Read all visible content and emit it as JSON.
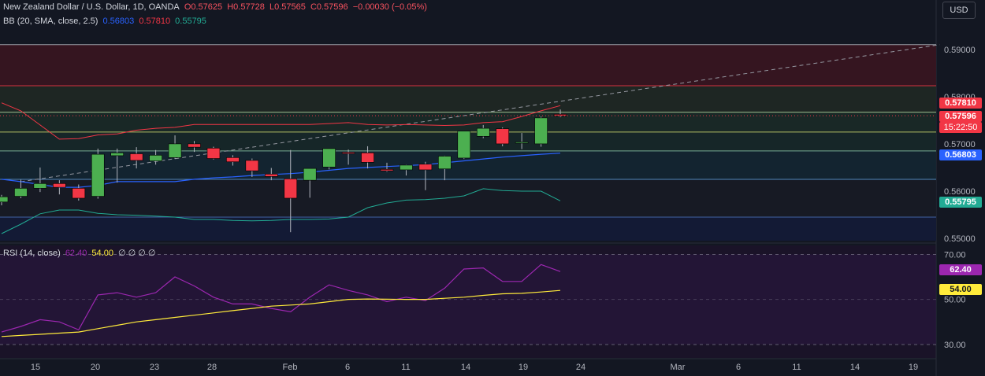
{
  "header": {
    "symbol_line": "New Zealand Dollar / U.S. Dollar, 1D, OANDA",
    "open": "O0.57625",
    "high": "H0.57728",
    "low": "L0.57565",
    "close": "C0.57596",
    "change": "−0.00030 (−0.05%)",
    "bb_label": "BB (20, SMA, close, 2.5)",
    "bb_basis": "0.56803",
    "bb_upper": "0.57810",
    "bb_lower": "0.55795",
    "currency_button": "USD"
  },
  "rsi_legend": {
    "label": "RSI (14, close)",
    "rsi_value": "62.40",
    "ma_value": "54.00",
    "extra": "∅ ∅ ∅ ∅"
  },
  "price_tags": {
    "upper": "0.57810",
    "last": "0.57596",
    "countdown": "15:22:50",
    "basis": "0.56803",
    "lower": "0.55795",
    "rsi": "62.40",
    "rsi_ma": "54.00"
  },
  "colors": {
    "background": "#131722",
    "bull": "#4caf50",
    "bear": "#f23645",
    "bb_upper": "#f23645",
    "bb_basis": "#2962ff",
    "bb_lower": "#22ab94",
    "rsi": "#9c27b0",
    "rsi_ma": "#ffeb3b"
  },
  "chart_data": [
    {
      "type": "candlestick",
      "title": "New Zealand Dollar / U.S. Dollar, 1D, OANDA",
      "x_ticks": [
        "15",
        "20",
        "23",
        "28",
        "Feb",
        "6",
        "11",
        "14",
        "19",
        "24",
        "Mar",
        "6",
        "11",
        "14",
        "19"
      ],
      "y_ticks": [
        "0.55000",
        "0.56000",
        "0.57000",
        "0.58000",
        "0.59000"
      ],
      "ylim": [
        0.5495,
        0.5918
      ],
      "candles": [
        {
          "o": 0.5577,
          "h": 0.5592,
          "l": 0.557,
          "c": 0.5588
        },
        {
          "o": 0.5589,
          "h": 0.5624,
          "l": 0.5585,
          "c": 0.5606
        },
        {
          "o": 0.5606,
          "h": 0.565,
          "l": 0.5598,
          "c": 0.5616
        },
        {
          "o": 0.5616,
          "h": 0.5623,
          "l": 0.5593,
          "c": 0.5608
        },
        {
          "o": 0.5606,
          "h": 0.5614,
          "l": 0.558,
          "c": 0.5585
        },
        {
          "o": 0.5589,
          "h": 0.569,
          "l": 0.5584,
          "c": 0.5678
        },
        {
          "o": 0.5675,
          "h": 0.569,
          "l": 0.5618,
          "c": 0.5681
        },
        {
          "o": 0.5679,
          "h": 0.5693,
          "l": 0.5648,
          "c": 0.5665
        },
        {
          "o": 0.5664,
          "h": 0.5687,
          "l": 0.5656,
          "c": 0.5676
        },
        {
          "o": 0.5671,
          "h": 0.5718,
          "l": 0.5668,
          "c": 0.57
        },
        {
          "o": 0.57,
          "h": 0.5706,
          "l": 0.5683,
          "c": 0.5693
        },
        {
          "o": 0.5691,
          "h": 0.5694,
          "l": 0.5667,
          "c": 0.5669
        },
        {
          "o": 0.5671,
          "h": 0.5676,
          "l": 0.5654,
          "c": 0.5662
        },
        {
          "o": 0.5665,
          "h": 0.5669,
          "l": 0.563,
          "c": 0.5643
        },
        {
          "o": 0.5636,
          "h": 0.5649,
          "l": 0.5623,
          "c": 0.5631
        },
        {
          "o": 0.5626,
          "h": 0.5687,
          "l": 0.5513,
          "c": 0.5585
        },
        {
          "o": 0.5623,
          "h": 0.5648,
          "l": 0.5586,
          "c": 0.5648
        },
        {
          "o": 0.5651,
          "h": 0.569,
          "l": 0.5646,
          "c": 0.569
        },
        {
          "o": 0.5682,
          "h": 0.5688,
          "l": 0.5656,
          "c": 0.5681
        },
        {
          "o": 0.5681,
          "h": 0.5695,
          "l": 0.5648,
          "c": 0.5661
        },
        {
          "o": 0.5646,
          "h": 0.566,
          "l": 0.5641,
          "c": 0.5643
        },
        {
          "o": 0.5645,
          "h": 0.5656,
          "l": 0.5633,
          "c": 0.5655
        },
        {
          "o": 0.5657,
          "h": 0.5662,
          "l": 0.5602,
          "c": 0.5645
        },
        {
          "o": 0.5647,
          "h": 0.5675,
          "l": 0.5623,
          "c": 0.5674
        },
        {
          "o": 0.567,
          "h": 0.5727,
          "l": 0.5668,
          "c": 0.5727
        },
        {
          "o": 0.5716,
          "h": 0.574,
          "l": 0.5712,
          "c": 0.5733
        },
        {
          "o": 0.5732,
          "h": 0.5735,
          "l": 0.5695,
          "c": 0.57
        },
        {
          "o": 0.5702,
          "h": 0.5723,
          "l": 0.5689,
          "c": 0.5704
        },
        {
          "o": 0.57,
          "h": 0.5758,
          "l": 0.5694,
          "c": 0.5755
        },
        {
          "o": 0.57625,
          "h": 0.57728,
          "l": 0.57565,
          "c": 0.57596
        }
      ],
      "bb_upper": [
        0.5787,
        0.577,
        0.574,
        0.571,
        0.5711,
        0.5719,
        0.5721,
        0.5729,
        0.5733,
        0.5735,
        0.5741,
        0.5741,
        0.5741,
        0.5741,
        0.5741,
        0.5741,
        0.5741,
        0.5743,
        0.5745,
        0.5741,
        0.574,
        0.5741,
        0.574,
        0.5739,
        0.574,
        0.5745,
        0.5747,
        0.5758,
        0.577,
        0.5781
      ],
      "bb_basis": [
        0.5625,
        0.562,
        0.5614,
        0.5608,
        0.5608,
        0.5612,
        0.562,
        0.562,
        0.562,
        0.562,
        0.5625,
        0.5628,
        0.563,
        0.5633,
        0.5635,
        0.5637,
        0.564,
        0.5644,
        0.5648,
        0.565,
        0.5652,
        0.5654,
        0.5656,
        0.566,
        0.5664,
        0.5668,
        0.5672,
        0.5675,
        0.5678,
        0.56803
      ],
      "bb_lower": [
        0.551,
        0.553,
        0.5552,
        0.556,
        0.556,
        0.5553,
        0.555,
        0.5549,
        0.5547,
        0.5545,
        0.554,
        0.554,
        0.5538,
        0.5537,
        0.5538,
        0.554,
        0.554,
        0.5541,
        0.5545,
        0.5565,
        0.5575,
        0.5581,
        0.5582,
        0.5585,
        0.559,
        0.5605,
        0.5601,
        0.56,
        0.56,
        0.55795
      ],
      "levels": [
        {
          "value": 0.591,
          "color": "#b2b5be"
        },
        {
          "value": 0.5823,
          "color": "#f23645"
        },
        {
          "value": 0.5767,
          "color": "#b2d8a0"
        },
        {
          "value": 0.5725,
          "color": "#cdd96e"
        },
        {
          "value": 0.5685,
          "color": "#89c4a8"
        },
        {
          "value": 0.5625,
          "color": "#5b9bd5"
        },
        {
          "value": 0.5545,
          "color": "#4a6fb5"
        }
      ],
      "trendline": {
        "from": {
          "i": 1,
          "v": 0.562
        },
        "to": {
          "i": 48.7,
          "v": 0.591
        }
      }
    },
    {
      "type": "line",
      "title": "RSI (14, close)",
      "y_ticks": [
        "30.00",
        "50.00",
        "70.00"
      ],
      "ylim": [
        24,
        74
      ],
      "rsi": [
        35.5,
        38.0,
        41.0,
        40.0,
        36.5,
        52.0,
        53.0,
        51.0,
        53.0,
        60.0,
        56.0,
        51.0,
        48.0,
        48.0,
        46.0,
        44.5,
        51.0,
        56.5,
        54.0,
        52.0,
        49.0,
        51.0,
        49.5,
        55.0,
        63.5,
        64.0,
        58.0,
        58.0,
        65.5,
        62.4
      ],
      "rsi_ma": [
        33.5,
        34.0,
        34.5,
        35.0,
        35.5,
        37.0,
        38.5,
        40.0,
        41.0,
        42.0,
        43.0,
        44.0,
        45.0,
        46.0,
        47.0,
        47.5,
        48.0,
        49.0,
        50.0,
        50.2,
        50.1,
        50.0,
        50.0,
        50.5,
        51.0,
        51.8,
        52.5,
        52.7,
        53.3,
        54.0
      ]
    }
  ]
}
